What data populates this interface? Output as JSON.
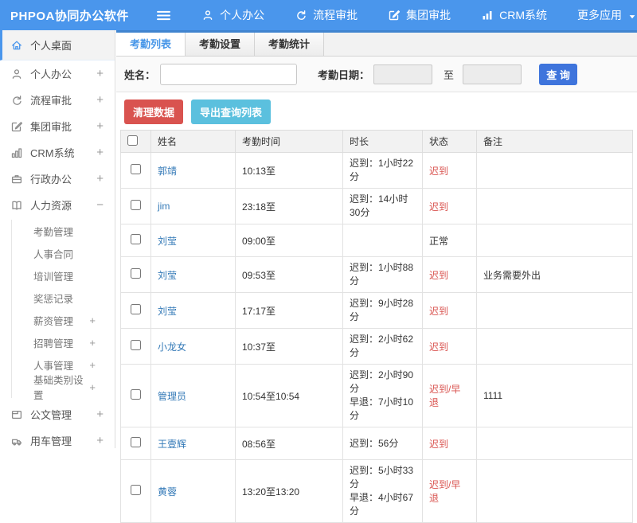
{
  "header": {
    "logo": "PHPOA协同办公软件",
    "nav": [
      {
        "label": "个人办公",
        "icon": "person-icon"
      },
      {
        "label": "流程审批",
        "icon": "flow-icon"
      },
      {
        "label": "集团审批",
        "icon": "edit-icon"
      },
      {
        "label": "CRM系统",
        "icon": "chart-icon"
      },
      {
        "label": "更多应用",
        "icon": "caret-down-icon"
      }
    ]
  },
  "sidebar": {
    "items": [
      {
        "label": "个人桌面",
        "icon": "home-icon",
        "active": true
      },
      {
        "label": "个人办公",
        "icon": "person-icon",
        "expand": "+"
      },
      {
        "label": "流程审批",
        "icon": "flow-icon",
        "expand": "+"
      },
      {
        "label": "集团审批",
        "icon": "edit-icon",
        "expand": "+"
      },
      {
        "label": "CRM系统",
        "icon": "chart-icon",
        "expand": "+"
      },
      {
        "label": "行政办公",
        "icon": "briefcase-icon",
        "expand": "+"
      },
      {
        "label": "人力资源",
        "icon": "book-icon",
        "expand": "−",
        "children": [
          {
            "label": "考勤管理",
            "expand": ""
          },
          {
            "label": "人事合同",
            "expand": ""
          },
          {
            "label": "培训管理",
            "expand": ""
          },
          {
            "label": "奖惩记录",
            "expand": ""
          },
          {
            "label": "薪资管理",
            "expand": "+"
          },
          {
            "label": "招聘管理",
            "expand": "+"
          },
          {
            "label": "人事管理",
            "expand": "+"
          },
          {
            "label": "基础类别设置",
            "expand": "+"
          }
        ]
      },
      {
        "label": "公文管理",
        "icon": "document-icon",
        "expand": "+"
      },
      {
        "label": "用车管理",
        "icon": "car-icon",
        "expand": "+"
      }
    ]
  },
  "tabs": [
    {
      "label": "考勤列表",
      "active": true
    },
    {
      "label": "考勤设置",
      "active": false
    },
    {
      "label": "考勤统计",
      "active": false
    }
  ],
  "search": {
    "name_label": "姓名：",
    "name_value": "",
    "date_label": "考勤日期：",
    "date_from_value": "",
    "to_label": "至",
    "date_to_value": "",
    "query_button": "查 询"
  },
  "toolbar": {
    "clean_button": "清理数据",
    "export_button": "导出查询列表"
  },
  "table": {
    "columns": [
      "姓名",
      "考勤时间",
      "时长",
      "状态",
      "备注"
    ],
    "rows": [
      {
        "name": "郭靖",
        "time": "10:13至",
        "duration": [
          "迟到：1小时22分"
        ],
        "status": "迟到",
        "alert": true,
        "note": ""
      },
      {
        "name": "jim",
        "time": "23:18至",
        "duration": [
          "迟到：14小时30分"
        ],
        "status": "迟到",
        "alert": true,
        "note": ""
      },
      {
        "name": "刘莹",
        "time": "09:00至",
        "duration": [],
        "status": "正常",
        "alert": false,
        "note": ""
      },
      {
        "name": "刘莹",
        "time": "09:53至",
        "duration": [
          "迟到：1小时88分"
        ],
        "status": "迟到",
        "alert": true,
        "note": "业务需要外出"
      },
      {
        "name": "刘莹",
        "time": "17:17至",
        "duration": [
          "迟到：9小时28分"
        ],
        "status": "迟到",
        "alert": true,
        "note": ""
      },
      {
        "name": "小龙女",
        "time": "10:37至",
        "duration": [
          "迟到：2小时62分"
        ],
        "status": "迟到",
        "alert": true,
        "note": ""
      },
      {
        "name": "管理员",
        "time": "10:54至10:54",
        "duration": [
          "迟到：2小时90分",
          "早退：7小时10分"
        ],
        "status": "迟到/早退",
        "alert": true,
        "note": "1111"
      },
      {
        "name": "王壹辉",
        "time": "08:56至",
        "duration": [
          "迟到：56分"
        ],
        "status": "迟到",
        "alert": true,
        "note": ""
      },
      {
        "name": "黄蓉",
        "time": "13:20至13:20",
        "duration": [
          "迟到：5小时33分",
          "早退：4小时67分"
        ],
        "status": "迟到/早退",
        "alert": true,
        "note": ""
      }
    ]
  },
  "colors": {
    "header_blue": "#4a96ec",
    "accent_blue": "#4796e8",
    "query_button_blue": "#3e74dc",
    "danger_red": "#d9534f",
    "info_cyan": "#5bc0de",
    "link_blue": "#3379b7",
    "status_late_red": "#d9534f"
  }
}
